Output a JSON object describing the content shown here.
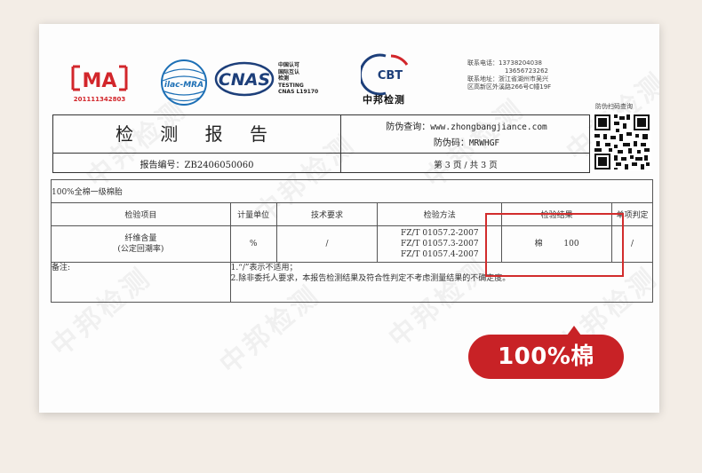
{
  "logos": {
    "cma_text": "MA",
    "cma_number": "201111342803",
    "ilac_text": "ilac-MRA",
    "cnas_text": "CNAS",
    "cnas_lines": [
      "中国认可",
      "国际互认",
      "检测",
      "TESTING",
      "CNAS L19170"
    ],
    "cbt_text": "CBT",
    "cbt_name": "中邦检测"
  },
  "contact": {
    "phone_label": "联系电话：",
    "phone1": "13738204038",
    "phone2": "13656723262",
    "address_label": "联系地址：",
    "address1": "浙江省湖州市吴兴",
    "address2": "区高新区外溪路266号C幢19F"
  },
  "qr": {
    "caption": "防伪扫码查询"
  },
  "report": {
    "title": "检 测 报 告",
    "number_label": "报告编号：",
    "number": "ZB2406050060",
    "anti_fake_label": "防伪查询：",
    "anti_fake_url": "www.zhongbangjiance.com",
    "anti_code_label": "防伪码：",
    "anti_code": "MRWHGF",
    "page_info": "第 3 页 / 共 3 页"
  },
  "table": {
    "product": "100%全棉一级棉胎",
    "headers": [
      "检验项目",
      "计量单位",
      "技术要求",
      "检验方法",
      "检验结果",
      "单项判定"
    ],
    "row": {
      "item_line1": "纤维含量",
      "item_line2": "(公定回潮率)",
      "unit": "%",
      "requirement": "/",
      "methods": [
        "FZ/T 01057.2-2007",
        "FZ/T 01057.3-2007",
        "FZ/T 01057.4-2007"
      ],
      "result_fiber": "棉",
      "result_value": "100",
      "judgement": "/"
    },
    "notes_label": "备注:",
    "notes": [
      "1.“/”表示不适用；",
      "2.除非委托人要求，本报告检测结果及符合性判定不考虑测量结果的不确定度。"
    ]
  },
  "callout": "100%棉",
  "watermark": "中邦检测",
  "colors": {
    "accent_red": "#c82226",
    "cnas_blue": "#1d3f7a",
    "ilac_blue": "#1c6fb5"
  }
}
